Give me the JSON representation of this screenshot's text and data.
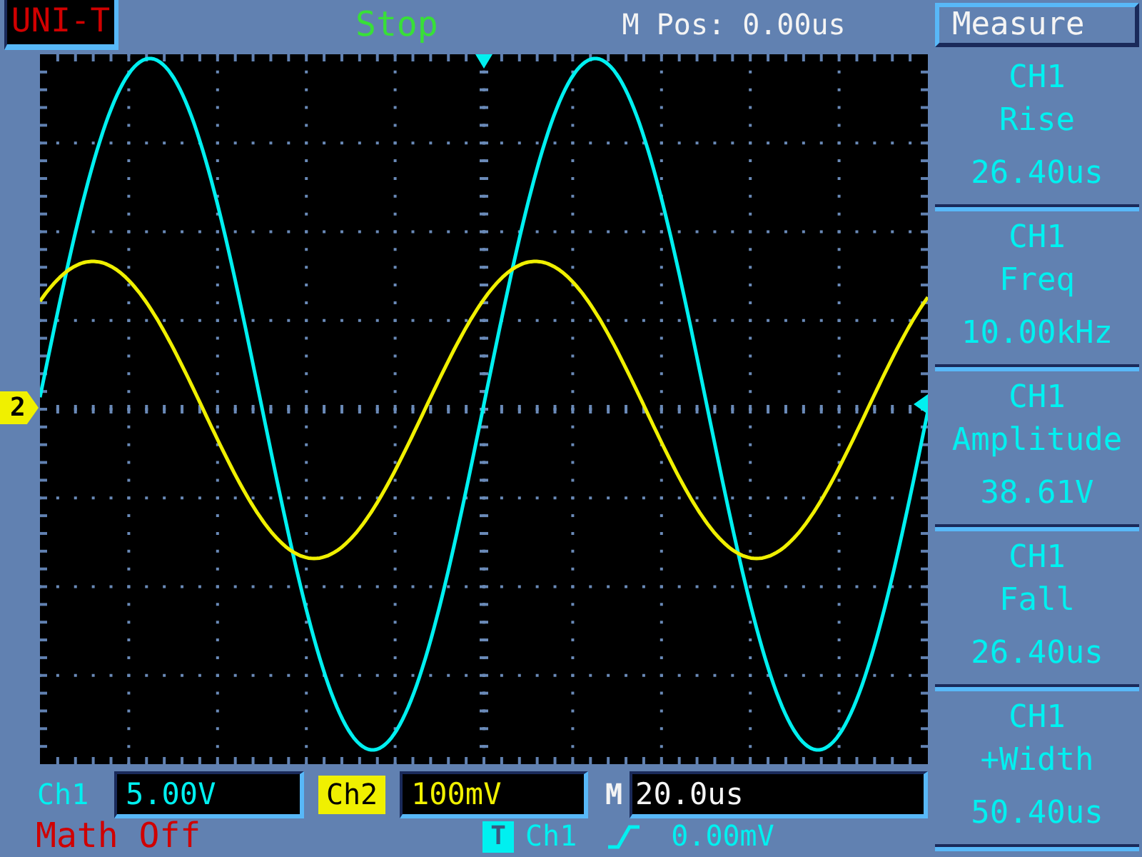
{
  "top_bar": {
    "logo": "UNI-T",
    "run_state": "Stop",
    "horizontal_position": "M Pos: 0.00us"
  },
  "measure_panel": {
    "title": "Measure",
    "items": [
      {
        "source": "CH1",
        "measurement": "Rise",
        "value": "26.40us"
      },
      {
        "source": "CH1",
        "measurement": "Freq",
        "value": "10.00kHz"
      },
      {
        "source": "CH1",
        "measurement": "Amplitude",
        "value": "38.61V"
      },
      {
        "source": "CH1",
        "measurement": "Fall",
        "value": "26.40us"
      },
      {
        "source": "CH1",
        "measurement": "+Width",
        "value": "50.40us"
      }
    ]
  },
  "channels": [
    {
      "label": "Ch1",
      "scale": "5.00V",
      "color": "#00f0f0",
      "selected": false
    },
    {
      "label": "Ch2",
      "scale": "100mV",
      "color": "#f0f000",
      "selected": true,
      "marker": "2"
    }
  ],
  "timebase": {
    "label": "M",
    "value": "20.0us"
  },
  "math_status": "Math Off",
  "trigger": {
    "badge": "T",
    "source": "Ch1",
    "threshold": "0.00mV"
  }
}
